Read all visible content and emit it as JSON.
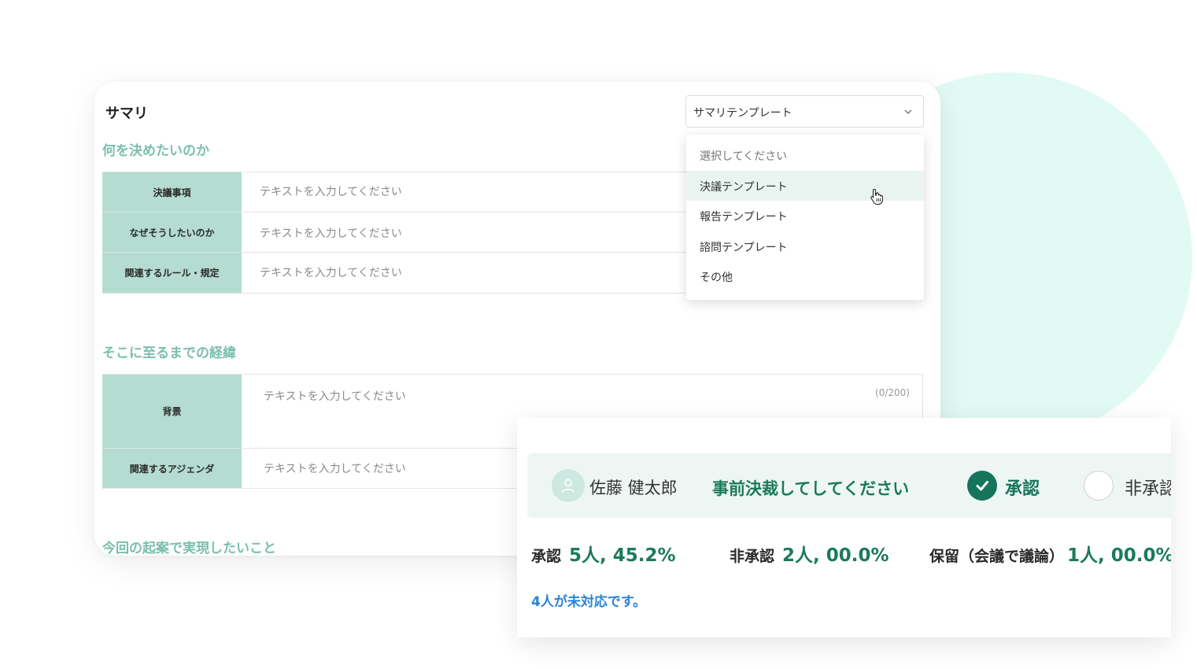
{
  "summary": {
    "title": "サマリ",
    "template_select": {
      "value": "サマリテンプレート"
    },
    "sections": [
      {
        "heading": "何を決めたいのか",
        "rows": [
          {
            "label": "決議事項",
            "placeholder": "テキストを入力してください"
          },
          {
            "label": "なぜそうしたいのか",
            "placeholder": "テキストを入力してください"
          },
          {
            "label": "関連するルール・規定",
            "placeholder": "テキストを入力してください"
          }
        ]
      },
      {
        "heading": "そこに至るまでの経緯",
        "rows": [
          {
            "label": "背景",
            "placeholder": "テキストを入力してください",
            "counter": "(0/200)"
          },
          {
            "label": "関連するアジェンダ",
            "placeholder": "テキストを入力してください"
          }
        ]
      },
      {
        "heading": "今回の起案で実現したいこと"
      }
    ]
  },
  "dropdown": {
    "options": [
      {
        "label": "選択してください",
        "placeholder": true
      },
      {
        "label": "決議テンプレート",
        "hovered": true
      },
      {
        "label": "報告テンプレート"
      },
      {
        "label": "諮問テンプレート"
      },
      {
        "label": "その他"
      }
    ]
  },
  "approval": {
    "user_name": "佐藤 健太郎",
    "request_text": "事前決裁してしてください",
    "options": [
      {
        "label": "承認",
        "selected": true
      },
      {
        "label": "非承認",
        "selected": false
      }
    ],
    "stats": [
      {
        "label": "承認",
        "value": "5人, 45.2%"
      },
      {
        "label": "非承認",
        "value": "2人, 00.0%"
      },
      {
        "label": "保留（会議で議論）",
        "value": "1人, 00.0%"
      }
    ],
    "pending_text": "4人が未対応です。"
  },
  "colors": {
    "accent": "#15745a",
    "label_bg": "#b4dcd1",
    "section_heading": "#7bbfae",
    "link": "#2a82d8",
    "bg_circle": "#e2faf4"
  }
}
